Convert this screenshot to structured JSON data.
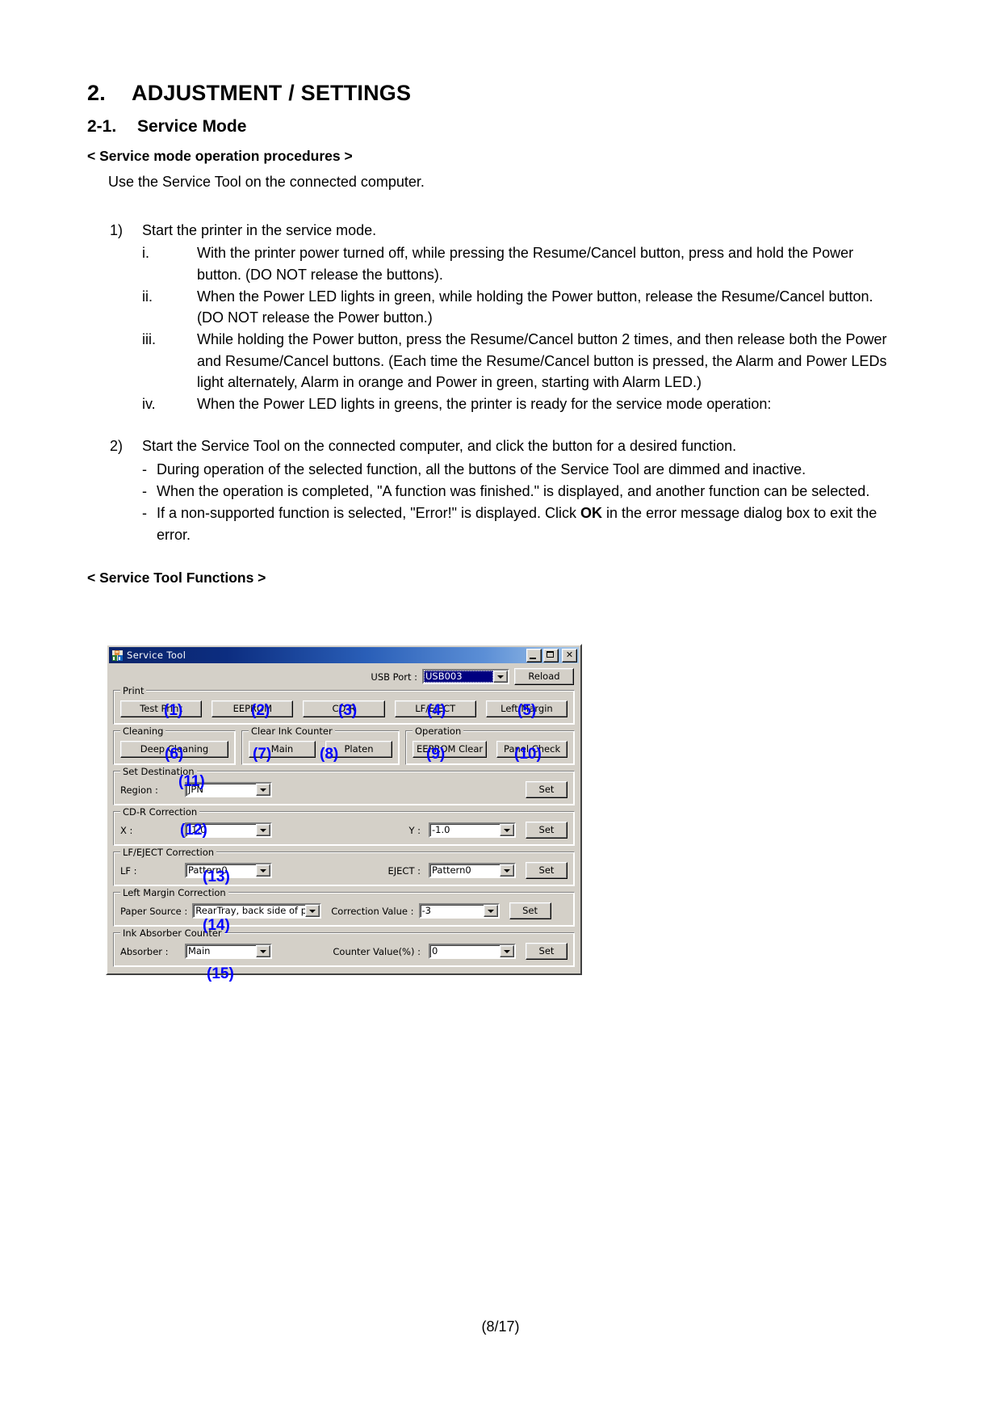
{
  "document": {
    "chapter_number": "2.",
    "chapter_title": "ADJUSTMENT / SETTINGS",
    "section_number": "2-1.",
    "section_title": "Service Mode",
    "procedures_heading": "< Service mode operation procedures >",
    "intro": "Use the Service Tool on the connected computer.",
    "step1": {
      "marker": "1)",
      "text": "Start the printer in the service mode.",
      "substeps": [
        {
          "marker": "i.",
          "text": "With the printer power turned off, while pressing the Resume/Cancel button, press and hold the Power button. (DO NOT release the buttons)."
        },
        {
          "marker": "ii.",
          "text": "When the Power LED lights in green, while holding the Power button, release the Resume/Cancel button. (DO NOT release the Power button.)"
        },
        {
          "marker": "iii.",
          "text": "While holding the Power button, press the Resume/Cancel button 2 times, and then release both the Power and Resume/Cancel buttons. (Each time the Resume/Cancel button is pressed, the Alarm and Power LEDs light alternately, Alarm in orange and Power in green, starting with Alarm LED.)"
        },
        {
          "marker": "iv.",
          "text": "When the Power LED lights in greens, the printer is ready for the service mode operation:"
        }
      ]
    },
    "step2": {
      "marker": "2)",
      "text": "Start the Service Tool on the connected computer, and click the button for a desired function.",
      "notes": [
        {
          "marker": "-",
          "prefix": "During operation of the selected function, all the buttons of the Service Tool are dimmed and inactive.",
          "bold": "",
          "suffix": ""
        },
        {
          "marker": "-",
          "prefix": "When the operation is completed, \"A function was finished.\" is displayed, and another function can be selected.",
          "bold": "",
          "suffix": ""
        },
        {
          "marker": "-",
          "prefix": "If a non-supported function is selected, \"Error!\" is displayed. Click ",
          "bold": "OK",
          "suffix": " in the error message dialog box to exit the error."
        }
      ]
    },
    "functions_heading": "< Service Tool Functions >",
    "page_footer": "(8/17)"
  },
  "dialog": {
    "title": "Service Tool",
    "icon": "service-tool-icon",
    "window_buttons": {
      "minimize": "minimize-icon",
      "maximize": "maximize-icon",
      "close": "close-icon"
    },
    "usb_port": {
      "label": "USB Port :",
      "value": "USB003",
      "reload_label": "Reload"
    },
    "print_group": {
      "title": "Print",
      "buttons": [
        {
          "label": "Test Print",
          "callout": "(1)"
        },
        {
          "label": "EEPROM",
          "callout": "(2)"
        },
        {
          "label": "CD-R",
          "callout": "(3)"
        },
        {
          "label": "LF/EJECT",
          "callout": "(4)"
        },
        {
          "label": "Left Margin",
          "callout": "(5)"
        }
      ]
    },
    "cleaning_group": {
      "title": "Cleaning",
      "buttons": [
        {
          "label": "Deep Cleaning",
          "callout": "(6)"
        }
      ]
    },
    "clear_ink_group": {
      "title": "Clear Ink Counter",
      "buttons": [
        {
          "label": "Main",
          "callout": "(7)"
        },
        {
          "label": "Platen",
          "callout": "(8)"
        }
      ]
    },
    "operation_group": {
      "title": "Operation",
      "buttons": [
        {
          "label": "EEPROM Clear",
          "callout": "(9)"
        },
        {
          "label": "Panel Check",
          "callout": "(10)"
        }
      ]
    },
    "set_destination_group": {
      "title": "Set Destination",
      "callout": "(11)",
      "region_label": "Region :",
      "region_value": "JPN",
      "set_label": "Set"
    },
    "cdr_correction_group": {
      "title": "CD-R Correction",
      "callout": "(12)",
      "x_label": "X :",
      "x_value": "-1.0",
      "y_label": "Y :",
      "y_value": "-1.0",
      "set_label": "Set"
    },
    "lf_eject_group": {
      "title": "LF/EJECT Correction",
      "callout": "(13)",
      "lf_label": "LF :",
      "lf_value": "Pattern0",
      "eject_label": "EJECT :",
      "eject_value": "Pattern0",
      "set_label": "Set"
    },
    "left_margin_group": {
      "title": "Left Margin Correction",
      "callout": "(14)",
      "paper_source_label": "Paper Source :",
      "paper_source_value": "RearTray, back side of pap",
      "correction_label": "Correction Value :",
      "correction_value": "-3",
      "set_label": "Set"
    },
    "ink_absorber_group": {
      "title": "Ink Absorber Counter",
      "callout": "(15)",
      "absorber_label": "Absorber :",
      "absorber_value": "Main",
      "counter_label": "Counter Value(%) :",
      "counter_value": "0",
      "set_label": "Set"
    }
  }
}
